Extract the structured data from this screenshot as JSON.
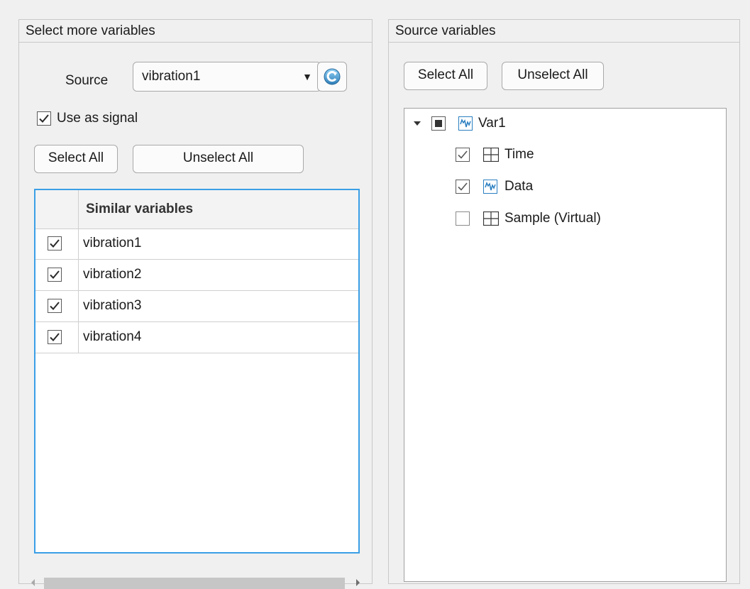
{
  "left_panel": {
    "title": "Select more variables",
    "source_label": "Source",
    "source_value": "vibration1",
    "refresh_icon": "refresh-icon",
    "use_as_signal": {
      "label": "Use as signal",
      "checked": true
    },
    "select_all": "Select All",
    "unselect_all": "Unselect All",
    "table": {
      "header": "Similar variables",
      "rows": [
        {
          "name": "vibration1",
          "checked": true
        },
        {
          "name": "vibration2",
          "checked": true
        },
        {
          "name": "vibration3",
          "checked": true
        },
        {
          "name": "vibration4",
          "checked": true
        }
      ]
    }
  },
  "right_panel": {
    "title": "Source variables",
    "select_all": "Select All",
    "unselect_all": "Unselect All",
    "tree": {
      "root": {
        "label": "Var1",
        "state": "partial",
        "icon": "signal-icon",
        "expanded": true
      },
      "children": [
        {
          "label": "Time",
          "checked": true,
          "icon": "table-icon"
        },
        {
          "label": "Data",
          "checked": true,
          "icon": "signal-icon"
        },
        {
          "label": "Sample (Virtual)",
          "checked": false,
          "icon": "table-icon"
        }
      ]
    }
  },
  "colors": {
    "background": "#f0f0f0",
    "table_focus_border": "#3a9fe6",
    "signal_icon": "#2a7fc1"
  }
}
